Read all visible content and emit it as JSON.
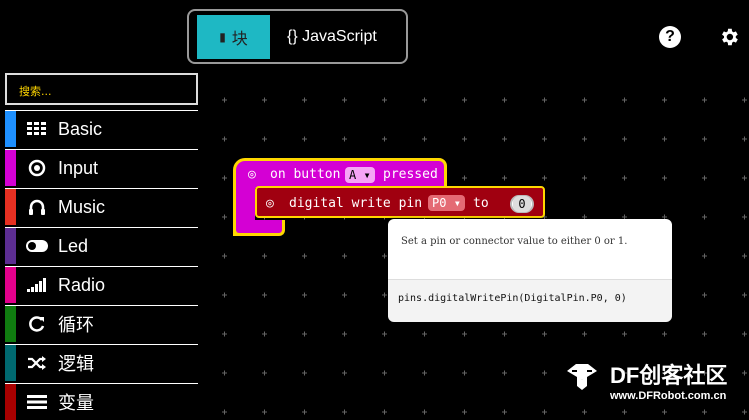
{
  "editor_switch": {
    "blocks_label": "块",
    "javascript_label": "{} JavaScript"
  },
  "header_icons": [
    "help-icon",
    "gear-icon"
  ],
  "toolbox": {
    "search_placeholder": "搜索...",
    "categories": [
      {
        "label": "Basic",
        "icon": "grid-icon",
        "color": "#1e90ff"
      },
      {
        "label": "Input",
        "icon": "target-icon",
        "color": "#d400d4"
      },
      {
        "label": "Music",
        "icon": "headphones-icon",
        "color": "#e63022"
      },
      {
        "label": "Led",
        "icon": "toggle-icon",
        "color": "#5c2d91"
      },
      {
        "label": "Radio",
        "icon": "signal-bars-icon",
        "color": "#e3008c"
      },
      {
        "label": "循环",
        "icon": "loop-icon",
        "color": "#107c10"
      },
      {
        "label": "逻辑",
        "icon": "shuffle-icon",
        "color": "#006970"
      },
      {
        "label": "变量",
        "icon": "list-icon",
        "color": "#a80000"
      }
    ]
  },
  "blocks": {
    "event": {
      "prefix": "on button",
      "dropdown": "A",
      "suffix": "pressed"
    },
    "statement": {
      "prefix": "digital write pin",
      "dropdown": "P0",
      "connector": "to",
      "value": "0"
    }
  },
  "tooltip": {
    "description": "Set a pin or connector value to either 0 or 1.",
    "code": "pins.digitalWritePin(DigitalPin.P0, 0)"
  },
  "watermark": {
    "title": "DF创客社区",
    "url": "www.DFRobot.com.cn"
  },
  "colors": {
    "accent": "#1eb8c4",
    "event_block": "#d400d4",
    "pins_block": "#a00010",
    "highlight": "#ffd800"
  }
}
